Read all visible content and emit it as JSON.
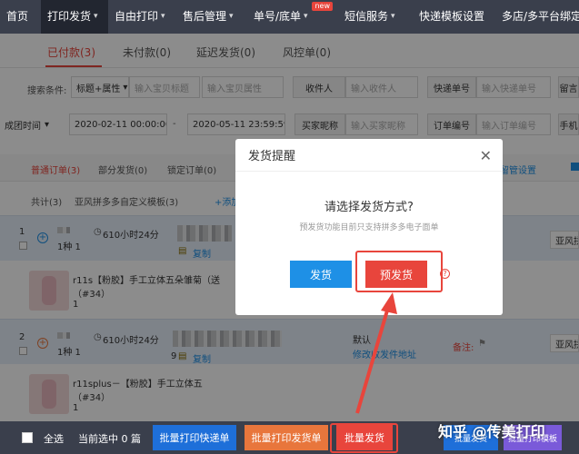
{
  "colors": {
    "nav_bg": "#3a3f4c",
    "accent": "#e8453c",
    "blue": "#1e90e6",
    "order_row": "#e6eef9"
  },
  "nav": {
    "items": [
      "首页",
      "打印发货",
      "自由打印",
      "售后管理",
      "单号/底单",
      "短信服务",
      "快递模板设置",
      "多店/多平台绑定"
    ],
    "new_badge": "new"
  },
  "tabs": [
    "已付款(3)",
    "未付款(0)",
    "延迟发货(0)",
    "风控单(0)"
  ],
  "search": {
    "cond_label": "搜索条件:",
    "cond_select": "标题+属性",
    "title_ph": "输入宝贝标题",
    "attr_ph": "输入宝贝属性",
    "receiver_btn": "收件人",
    "receiver_ph": "输入收件人",
    "express_btn": "快递单号",
    "express_ph": "输入快递单号",
    "more_btn": "留言",
    "time_select": "成团时间",
    "date_from": "2020-02-11 00:00:00",
    "date_sep": "-",
    "date_to": "2020-05-11 23:59:59",
    "buyer_btn": "买家昵称",
    "buyer_ph": "输入买家昵称",
    "order_btn": "订单编号",
    "order_ph": "输入订单编号",
    "phone_btn": "手机"
  },
  "subtabs": [
    "普通订单(3)",
    "部分发货(0)",
    "锁定订单(0)",
    "留管设置"
  ],
  "toolbar": {
    "total": "共计(3)",
    "template": "亚风拼多多自定义模板(3)",
    "add": "+添加"
  },
  "orders": [
    {
      "num": "1",
      "count": "1种 1",
      "timer": "610小时24分",
      "copy": "复制",
      "copy_count": "",
      "right": "亚风拼"
    },
    {
      "num": "2",
      "count": "1种 1",
      "timer": "610小时24分",
      "copy": "复制",
      "copy_count": "9",
      "default_addr": "默认",
      "edit_addr": "修改收发件地址",
      "remark": "备注:",
      "right": "亚风拼"
    }
  ],
  "products": [
    {
      "title": "r11s【粉胶】手工立体五朵雏菊（送",
      "spec": "（#34）",
      "qty": "1"
    },
    {
      "title": "r11splus－【粉胶】手工立体五",
      "spec": "（#34）",
      "qty": "1"
    }
  ],
  "modal": {
    "title": "发货提醒",
    "close": "✕",
    "question": "请选择发货方式?",
    "subtitle": "预发货功能目前只支持拼多多电子面单",
    "ship": "发货",
    "preship": "预发货",
    "help": "?"
  },
  "footer": {
    "select_all": "全选",
    "current": "当前选中 0 篇",
    "print_express": "批量打印快递单",
    "print_invoice": "批量打印发货单",
    "batch_ship": "批量发货",
    "right1": "批量发货",
    "right2": "批量打印模板"
  },
  "watermark": "知乎 @传美打印"
}
